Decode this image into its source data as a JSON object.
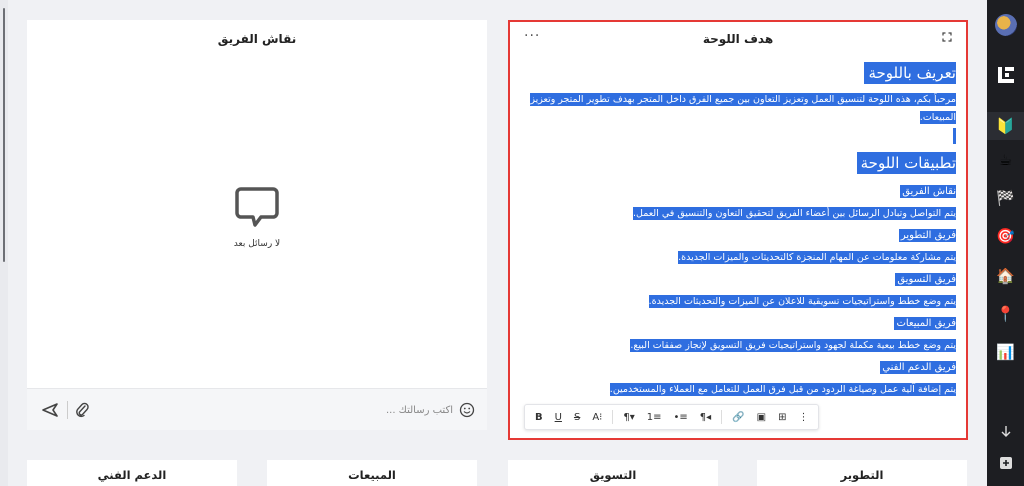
{
  "chat_panel": {
    "title": "نقاش الفريق",
    "empty_text": "لا رسائل بعد",
    "input_placeholder": "اكتب رسالتك ..."
  },
  "goal_panel": {
    "title": "هدف اللوحة",
    "heading_intro": "تعريف باللوحة",
    "intro_text": "مرحباً بكم، هذه اللوحة لتنسيق العمل وتعزيز التعاون بين جميع الفرق داخل المتجر بهدف تطوير المتجر وتعزيز المبيعات.",
    "heading_apps": "تطبيقات اللوحة",
    "sections": [
      {
        "title": "نقاش الفريق",
        "text": "يتم التواصل وتبادل الرسائل بين أعضاء الفريق لتحقيق التعاون والتنسيق في العمل."
      },
      {
        "title": "فريق التطوير",
        "text": "يتم مشاركة معلومات عن المهام المنجزة كالتحديثات والميزات الجديدة."
      },
      {
        "title": "فريق التسويق",
        "text": "يتم وضع خطط واستراتيجيات تسويقية للاعلان عن الميزات والتحديثات الجديدة."
      },
      {
        "title": "فريق المبيعات",
        "text": "يتم وضع خطط بيعية مكملة لجهود واستراتيجيات فريق التسويق لإنجاز صفقات البيع."
      },
      {
        "title": "فريق الدعم الفني",
        "text": "يتم إضافة آلية عمل وصياغة الردود من قبل فرق العمل للتعامل مع العملاء والمستخدمين."
      }
    ],
    "toolbar": {
      "bold": "B",
      "underline": "U",
      "strike": "S",
      "font_size": "A⁝",
      "paragraph": "¶▾",
      "ordered_list": "1≡",
      "bullet_list": "•≡",
      "rtl": "¶◂",
      "link": "🔗",
      "image": "▣",
      "table": "⊞",
      "more": "⋮"
    }
  },
  "cards": {
    "support": "الدعم الفني",
    "sales": "المبيعات",
    "marketing": "التسويق",
    "development": "التطوير"
  },
  "rail_icons": [
    "beginner-icon",
    "coffee-icon",
    "checkered-flag-icon",
    "target-icon",
    "home-icon",
    "pin-icon",
    "chart-icon"
  ],
  "colors": {
    "selection": "#2f6ee0",
    "highlight_border": "#e53935",
    "rail_bg": "#1d1e22"
  }
}
